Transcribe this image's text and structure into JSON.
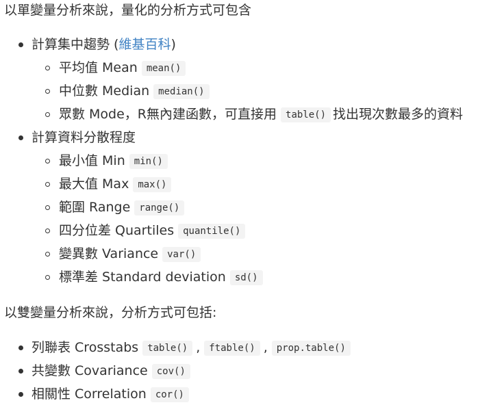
{
  "intro_univariate": "以單變量分析來說，量化的分析方式可包含",
  "central": {
    "label": "計算集中趨勢",
    "paren_open": " (",
    "link_text": "維基百科",
    "paren_close": ")",
    "items": [
      {
        "label": "平均值 Mean",
        "code": "mean()"
      },
      {
        "label": "中位數 Median",
        "code": "median()"
      },
      {
        "label": "眾數 Mode，R無內建函數，可直接用",
        "code": "table()",
        "suffix": "找出現次數最多的資料"
      }
    ]
  },
  "dispersion": {
    "label": "計算資料分散程度",
    "items": [
      {
        "label": "最小值 Min",
        "code": "min()"
      },
      {
        "label": "最大值 Max",
        "code": "max()"
      },
      {
        "label": "範圍 Range",
        "code": "range()"
      },
      {
        "label": "四分位差 Quartiles",
        "code": "quantile()"
      },
      {
        "label": "變異數 Variance",
        "code": "var()"
      },
      {
        "label": "標準差 Standard deviation",
        "code": "sd()"
      }
    ]
  },
  "intro_bivariate": "以雙變量分析來說，分析方式可包括:",
  "bivariate": {
    "items": [
      {
        "label": "列聯表 Crosstabs",
        "codes": [
          "table()",
          "ftable()",
          "prop.table()"
        ],
        "separator": ","
      },
      {
        "label": "共變數 Covariance",
        "code": "cov()"
      },
      {
        "label": "相關性 Correlation",
        "code": "cor()"
      }
    ]
  }
}
